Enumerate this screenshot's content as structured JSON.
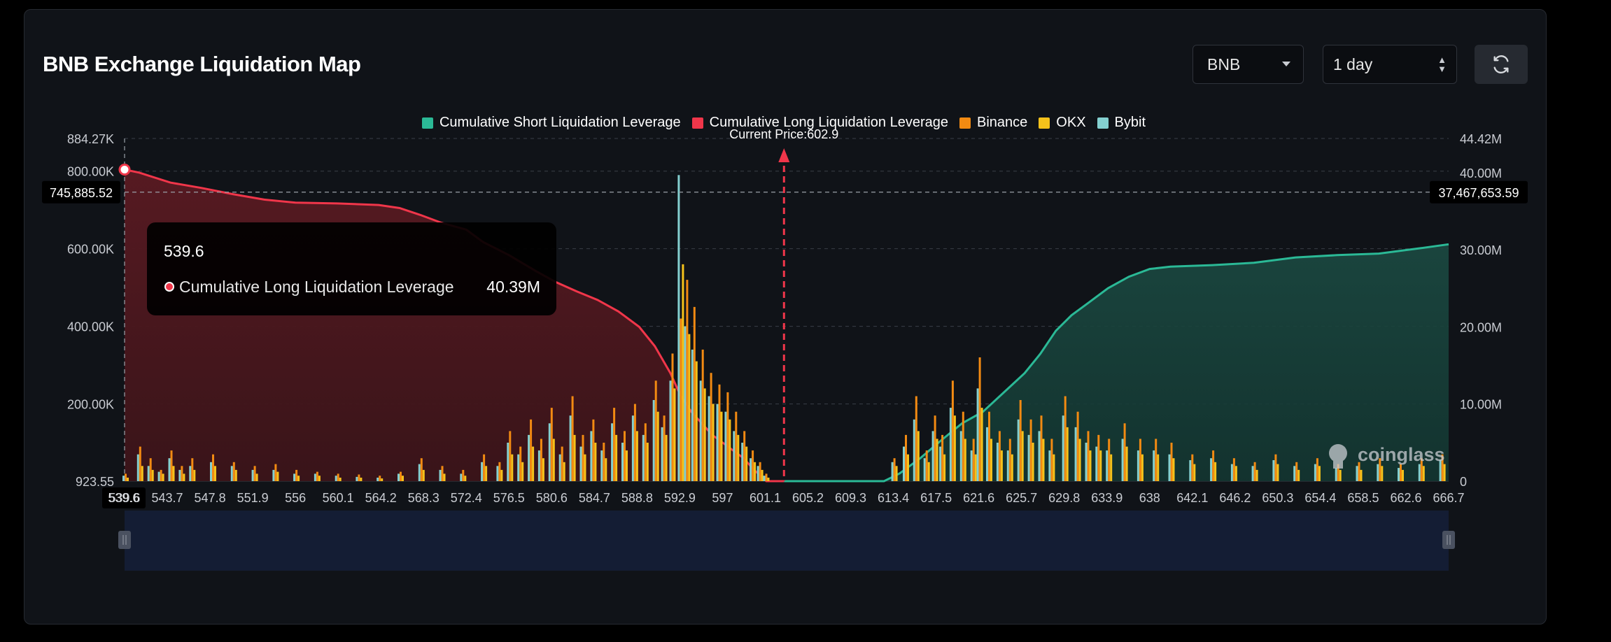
{
  "header": {
    "title": "BNB Exchange Liquidation Map",
    "symbol_select": "BNB",
    "period_select": "1 day"
  },
  "colors": {
    "short": "#2bb996",
    "long": "#f0364a",
    "binance": "#f28a12",
    "okx": "#f5c21b",
    "bybit": "#84d0d0"
  },
  "icons": [
    "chevron-down-icon",
    "up-down-icon",
    "refresh-icon",
    "coinglass-logo"
  ],
  "chart_data": {
    "type": "bar",
    "title": "BNB Exchange Liquidation Map",
    "current_price_label": "Current Price:602.9",
    "current_price": 602.9,
    "legend": [
      "Cumulative Short Liquidation Leverage",
      "Cumulative Long Liquidation Leverage",
      "Binance",
      "OKX",
      "Bybit"
    ],
    "x_ticks": [
      "539.6",
      "543.7",
      "547.8",
      "551.9",
      "556",
      "560.1",
      "564.2",
      "568.3",
      "572.4",
      "576.5",
      "580.6",
      "584.7",
      "588.8",
      "592.9",
      "597",
      "601.1",
      "605.2",
      "609.3",
      "613.4",
      "617.5",
      "621.6",
      "625.7",
      "629.8",
      "633.9",
      "638",
      "642.1",
      "646.2",
      "650.3",
      "654.4",
      "658.5",
      "662.6",
      "666.7"
    ],
    "xlim": [
      539.6,
      666.7
    ],
    "y_left_ticks": [
      "884.27K",
      "800.00K",
      "600.00K",
      "400.00K",
      "200.00K",
      "923.55"
    ],
    "y_left_tick_values": [
      884270,
      800000,
      600000,
      400000,
      200000,
      923.55
    ],
    "ylim_left": [
      923.55,
      884270
    ],
    "y_right_ticks": [
      "44.42M",
      "40.00M",
      "30.00M",
      "20.00M",
      "10.00M",
      "0"
    ],
    "y_right_tick_values": [
      44420000,
      40000000,
      30000000,
      20000000,
      10000000,
      0
    ],
    "ylim_right": [
      0,
      44420000
    ],
    "crosshair_left": "745,885.52",
    "crosshair_right": "37,467,653.59",
    "crosshair_x": "539.6",
    "tooltip": {
      "price": "539.6",
      "series": "Cumulative Long Liquidation Leverage",
      "value": "40.39M"
    },
    "watermark": "coinglass",
    "long_cumulative_M": {
      "x": [
        539.6,
        541,
        544,
        547,
        550,
        553,
        556,
        560,
        564,
        566,
        568,
        570,
        572.4,
        574,
        576.5,
        579,
        581,
        583,
        585,
        587,
        589,
        590.5,
        592,
        593,
        594,
        595,
        596,
        597,
        598,
        599,
        600,
        601.2,
        602.9
      ],
      "y": [
        40.39,
        40.0,
        38.7,
        38.0,
        37.2,
        36.5,
        36.1,
        36.0,
        35.8,
        35.4,
        34.5,
        33.5,
        32.6,
        31.0,
        29.3,
        27.3,
        25.8,
        24.6,
        23.5,
        22.0,
        20.0,
        17.5,
        14.0,
        11.0,
        9.0,
        7.5,
        6.0,
        5.0,
        4.0,
        3.0,
        1.5,
        0.0,
        0.0
      ]
    },
    "short_cumulative_M": {
      "x": [
        602.9,
        612.5,
        614,
        616,
        618,
        620,
        622,
        624,
        626,
        627.5,
        629,
        630.5,
        632,
        634,
        636,
        638,
        640,
        644,
        648,
        652,
        656,
        660,
        664,
        666.7
      ],
      "y": [
        0.0,
        0.0,
        1.0,
        3.0,
        5.3,
        7.5,
        9.0,
        11.5,
        14.0,
        16.5,
        19.5,
        21.5,
        23.0,
        25.0,
        26.5,
        27.5,
        27.8,
        28.0,
        28.3,
        29.0,
        29.3,
        29.5,
        30.2,
        30.7
      ]
    },
    "exchange_bars_K": {
      "note": "Binance / OKX / Bybit liquidation leverage per price level (thousands)",
      "x": [
        539.6,
        541,
        542,
        543,
        544,
        545,
        546,
        548,
        550,
        552,
        554,
        556,
        558,
        560,
        562,
        564,
        566,
        568,
        570,
        572,
        574,
        575.5,
        576.5,
        577.5,
        578.5,
        579.5,
        580.5,
        581.5,
        582.5,
        583.5,
        584.5,
        585.5,
        586.5,
        587.5,
        588.5,
        589.5,
        590.5,
        591.3,
        592.1,
        592.9,
        593.5,
        594.2,
        595,
        595.8,
        596.6,
        597.4,
        598.2,
        599,
        599.8,
        600.5,
        601.1,
        602.9,
        605,
        610,
        613.4,
        614.5,
        615.5,
        616.5,
        617.3,
        618,
        619,
        620,
        621,
        621.6,
        622.5,
        623.5,
        624.5,
        625.5,
        626.5,
        627.5,
        628.5,
        629.8,
        631,
        632,
        633,
        634,
        635.5,
        637,
        638.5,
        640,
        642,
        644,
        646,
        648,
        650,
        652,
        654,
        656,
        658,
        660,
        662,
        664,
        666
      ],
      "binance": [
        20,
        90,
        60,
        30,
        80,
        40,
        60,
        70,
        50,
        40,
        45,
        30,
        25,
        20,
        18,
        15,
        25,
        60,
        40,
        30,
        70,
        50,
        130,
        90,
        160,
        110,
        190,
        90,
        220,
        120,
        160,
        100,
        190,
        130,
        200,
        150,
        260,
        170,
        330,
        420,
        520,
        450,
        340,
        280,
        250,
        230,
        180,
        130,
        80,
        50,
        20,
        0,
        0,
        0,
        60,
        120,
        220,
        80,
        170,
        120,
        260,
        180,
        110,
        320,
        180,
        130,
        110,
        210,
        160,
        170,
        110,
        220,
        180,
        130,
        120,
        110,
        150,
        110,
        110,
        100,
        70,
        80,
        60,
        50,
        70,
        50,
        60,
        45,
        50,
        60,
        45,
        60,
        70
      ],
      "okx": [
        10,
        40,
        30,
        20,
        40,
        20,
        30,
        40,
        30,
        20,
        25,
        15,
        15,
        10,
        10,
        8,
        15,
        30,
        20,
        15,
        40,
        30,
        70,
        50,
        90,
        60,
        110,
        50,
        120,
        70,
        100,
        60,
        120,
        80,
        130,
        100,
        180,
        120,
        240,
        560,
        380,
        310,
        240,
        200,
        180,
        160,
        120,
        90,
        50,
        30,
        10,
        0,
        0,
        0,
        40,
        70,
        130,
        50,
        110,
        70,
        170,
        110,
        70,
        190,
        110,
        80,
        70,
        130,
        100,
        110,
        70,
        140,
        110,
        80,
        80,
        70,
        90,
        70,
        70,
        60,
        45,
        50,
        40,
        30,
        45,
        30,
        40,
        30,
        30,
        40,
        30,
        40,
        45
      ],
      "bybit": [
        15,
        70,
        40,
        25,
        60,
        30,
        40,
        50,
        40,
        30,
        30,
        20,
        20,
        15,
        12,
        10,
        20,
        45,
        30,
        20,
        50,
        40,
        100,
        70,
        120,
        80,
        150,
        70,
        170,
        90,
        130,
        80,
        150,
        100,
        170,
        120,
        210,
        140,
        260,
        790,
        400,
        340,
        260,
        220,
        200,
        180,
        130,
        100,
        60,
        40,
        15,
        0,
        0,
        0,
        50,
        90,
        160,
        60,
        130,
        90,
        190,
        130,
        80,
        240,
        140,
        100,
        80,
        160,
        120,
        130,
        80,
        170,
        140,
        100,
        90,
        80,
        110,
        80,
        80,
        70,
        55,
        60,
        45,
        40,
        55,
        40,
        45,
        35,
        40,
        45,
        35,
        45,
        55
      ]
    }
  }
}
